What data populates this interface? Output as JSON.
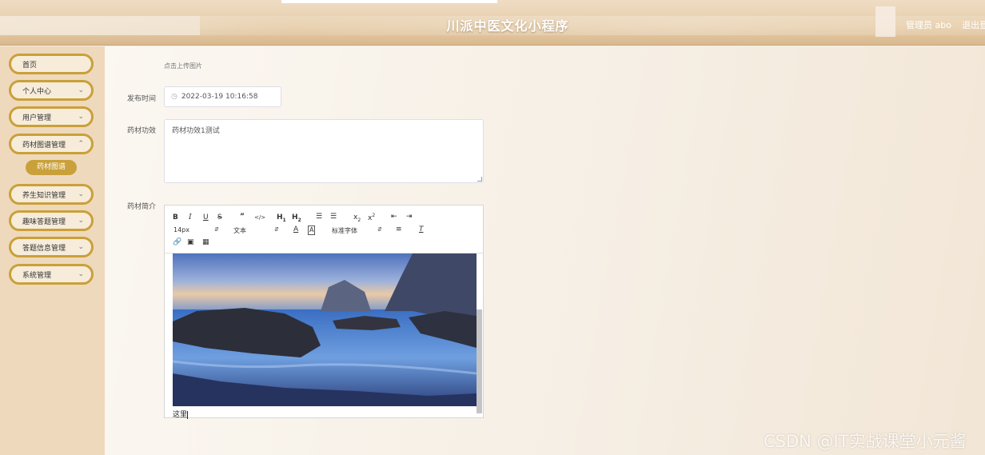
{
  "header": {
    "title": "川派中医文化小程序",
    "user_label": "管理员 abo",
    "logout_label": "退出登"
  },
  "sidebar": {
    "items": [
      {
        "label": "首页"
      },
      {
        "label": "个人中心"
      },
      {
        "label": "用户管理"
      },
      {
        "label": "药材图谱管理"
      },
      {
        "label": "养生知识管理"
      },
      {
        "label": "趣味答题管理"
      },
      {
        "label": "答题信息管理"
      },
      {
        "label": "系统管理"
      }
    ],
    "submenu": {
      "label": "药材图谱"
    }
  },
  "form": {
    "upload_hint": "点击上传图片",
    "publish_time_label": "发布时间",
    "publish_time_value": "2022-03-19 10:16:58",
    "efficacy_label": "药材功效",
    "efficacy_value": "药材功效1测试",
    "intro_label": "药材简介"
  },
  "editor": {
    "font_size": "14px",
    "text_type": "文本",
    "font_family": "标准字体",
    "content_text": "这里"
  },
  "watermark": "CSDN @IT实战课堂小元酱",
  "colors": {
    "accent": "#c9a03a",
    "sidebar_bg": "#efd9bc",
    "header_bg": "#e6cda9"
  }
}
